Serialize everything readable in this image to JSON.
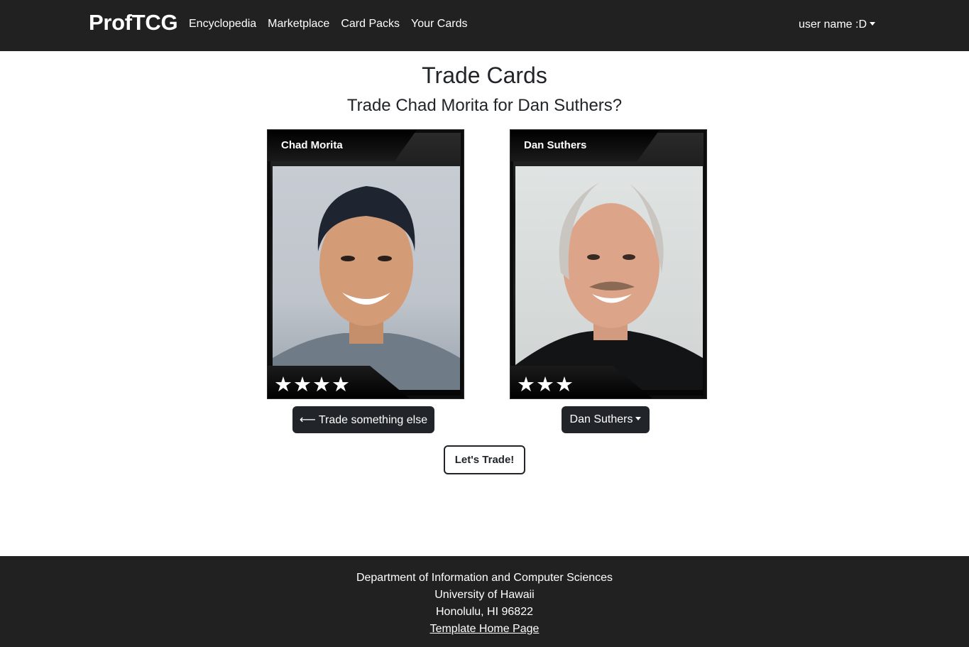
{
  "navbar": {
    "brand": "ProfTCG",
    "links": [
      "Encyclopedia",
      "Marketplace",
      "Card Packs",
      "Your Cards"
    ],
    "user_menu": "user name :D"
  },
  "page": {
    "title": "Trade Cards",
    "question": "Trade Chad Morita for Dan Suthers?"
  },
  "cards": [
    {
      "name": "Chad Morita",
      "stars": "★★★★",
      "rating": 4
    },
    {
      "name": "Dan Suthers",
      "stars": "★★★",
      "rating": 3
    }
  ],
  "actions": {
    "trade_else_arrow": "⟵",
    "trade_else_label": "Trade something else",
    "select_value": "Dan Suthers",
    "trade_button": "Let's Trade!"
  },
  "footer": {
    "line1": "Department of Information and Computer Sciences",
    "line2": "University of Hawaii",
    "line3": "Honolulu, HI 96822",
    "link": "Template Home Page"
  },
  "colors": {
    "navbar_bg": "#212121",
    "button_dark": "#212529",
    "page_bg": "#ffffff"
  }
}
